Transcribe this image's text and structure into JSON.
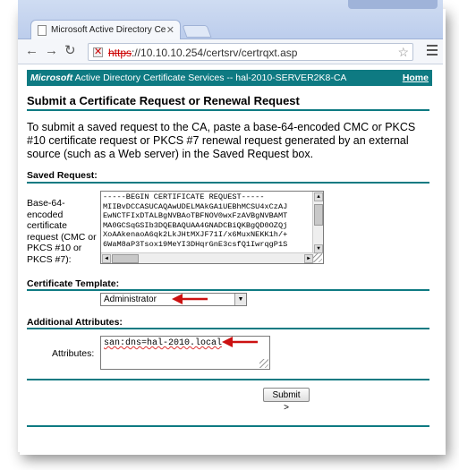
{
  "browser": {
    "tab_title": "Microsoft Active Directory Ce",
    "url_scheme": "https",
    "url_rest": "://10.10.10.254/certsrv/certrqxt.asp"
  },
  "page": {
    "banner_brand": "Microsoft",
    "banner_text": " Active Directory Certificate Services  --  hal-2010-SERVER2K8-CA",
    "home_link": "Home",
    "title": "Submit a Certificate Request or Renewal Request",
    "intro": "To submit a saved request to the CA, paste a base-64-encoded CMC or PKCS #10 certificate request or PKCS #7 renewal request generated by an external source (such as a Web server) in the Saved Request box.",
    "saved_request_heading": "Saved Request:",
    "saved_request_label": "Base-64-encoded certificate request (CMC or PKCS #10 or PKCS #7):",
    "saved_request_lines": [
      "-----BEGIN CERTIFICATE REQUEST-----",
      "MIIBvDCCASUCAQAwUDELMAkGA1UEBhMCSU4xCzAJ",
      "EwNCTFIxDTALBgNVBAoTBFNOV0wxFzAVBgNVBAMT",
      "MA0GCSqGSIb3DQEBAQUAA4GNADCBiQKBgQD0OZQj",
      "XoAAkenaoA6qk2LkJHtMXJF71I/x6MuxNEKK1h/+",
      "6WaM8aP3Tsox19MeYI3DHqrGnE3csfQ1IwrqgP1S"
    ],
    "template_heading": "Certificate Template:",
    "template_value": "Administrator",
    "attributes_heading": "Additional Attributes:",
    "attributes_label": "Attributes:",
    "attributes_value": "san:dns=hal-2010.local",
    "submit_label": "Submit >"
  },
  "colors": {
    "banner": "#0e7a82",
    "annotation_arrow": "#cc1111"
  }
}
